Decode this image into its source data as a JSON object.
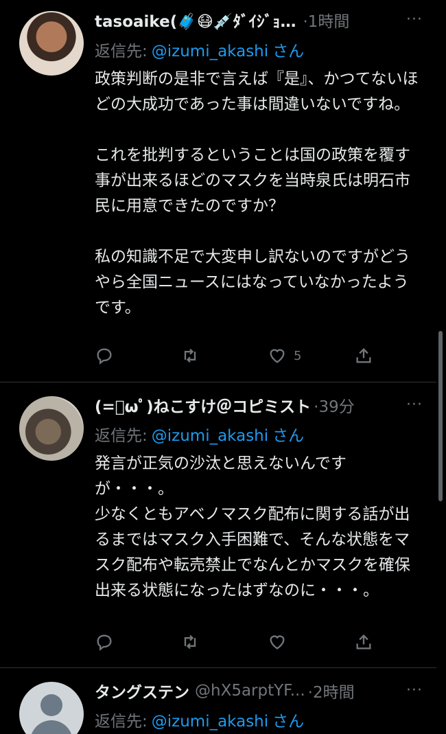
{
  "tweets": [
    {
      "name": "tasoaike(🧳😷💉ﾀﾞｲｼﾞｮ…",
      "handle": "",
      "time": "·1時間",
      "reply_prefix": "返信先:",
      "reply_mention": "@izumi_akashi",
      "reply_suffix": "さん",
      "text": "政策判断の是非で言えば『是』、かつてないほどの大成功であった事は間違いないですね。\n\nこれを批判するということは国の政策を覆す事が出来るほどのマスクを当時泉氏は明石市民に用意できたのですか？\n\n私の知識不足で大変申し訳ないのですがどうやら全国ニュースにはなっていなかったようです。",
      "like_count": "5"
    },
    {
      "name": "(=ﾟωﾟ)ねこすけ＠コピミスト",
      "handle": "",
      "time": "·39分",
      "reply_prefix": "返信先:",
      "reply_mention": "@izumi_akashi",
      "reply_suffix": "さん",
      "text": "発言が正気の沙汰と思えないんですが・・・。\n少なくともアベノマスク配布に関する話が出るまではマスク入手困難で、そんな状態をマスク配布や転売禁止でなんとかマスクを確保出来る状態になったはずなのに・・・。",
      "like_count": ""
    },
    {
      "name": "タングステン",
      "handle": "@hX5arptYF...",
      "time": "·2時間",
      "reply_prefix": "返信先:",
      "reply_mention": "@izumi_akashi",
      "reply_suffix": "さん"
    }
  ],
  "more_label": "···"
}
